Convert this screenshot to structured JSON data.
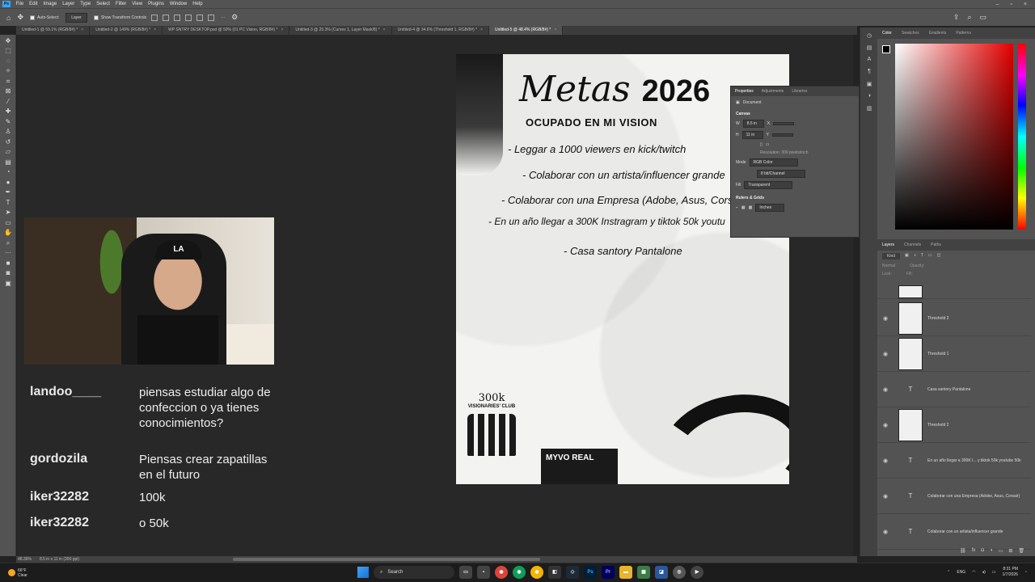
{
  "menubar": {
    "items": [
      "File",
      "Edit",
      "Image",
      "Layer",
      "Type",
      "Select",
      "Filter",
      "View",
      "Plugins",
      "Window",
      "Help"
    ],
    "logo": "Ps"
  },
  "options": {
    "auto_select_label": "Auto-Select:",
    "auto_select_value": "Layer",
    "show_transform_label": "Show Transform Controls",
    "more": "···"
  },
  "tabs": [
    {
      "label": "Untitled-1 @ 59.1% (RGB/8#) *"
    },
    {
      "label": "Untitled-2 @ 149% (RGB/8#) *"
    },
    {
      "label": "WP SNTRY DESKTOP.psd @ 50% (01 PC Vision, RGB/8#) *"
    },
    {
      "label": "Untitled-3 @ 25.3% (Curves 1, Layer Mask/8) *"
    },
    {
      "label": "Untitled-4 @ 34.6% (Threshold 1, RGB/8#) *"
    },
    {
      "label": "Untitled-5 @ 48.4% (RGB/8#) *"
    }
  ],
  "document": {
    "title_script": "Metas",
    "title_year": "2026",
    "subtitle": "OCUPADO EN MI VISION",
    "goals": [
      "- Leggar a 1000 viewers en kick/twitch",
      "- Colaborar con un artista/influencer grande",
      "- Colaborar con una Empresa (Adobe, Asus, Cors",
      "- En un año llegar a 300K Instragram y tiktok 50k youtu",
      "- Casa santory Pantalone"
    ],
    "club_number": "300k",
    "club_label": "VISIONARIES' CLUB",
    "sticker_text": "MYVO REAL"
  },
  "properties": {
    "tabs": [
      "Properties",
      "Adjustments",
      "Libraries"
    ],
    "document_label": "Document",
    "canvas_header": "Canvas",
    "width_label": "W",
    "width_value": "8.5 in",
    "height_label": "H",
    "height_value": "11 in",
    "x_label": "X",
    "y_label": "Y",
    "resolution": "Resolution: 300 pixels/inch",
    "mode_label": "Mode",
    "mode_value": "RGB Color",
    "bits_value": "8 bit/Channel",
    "fill_label": "Fill",
    "fill_value": "Transparent",
    "rulers_header": "Rulers & Grids",
    "units_value": "Inches"
  },
  "color_panel": {
    "tabs": [
      "Color",
      "Swatches",
      "Gradients",
      "Patterns"
    ]
  },
  "layers_panel": {
    "tabs": [
      "Layers",
      "Channels",
      "Paths"
    ],
    "kind_label": "Kind",
    "blend_label": "Normal",
    "opacity_label": "Opacity:",
    "lock_label": "Lock:",
    "fill_label": "Fill:",
    "layers": [
      {
        "name": "",
        "type": "pixel"
      },
      {
        "name": "Threshold 2",
        "type": "pixel"
      },
      {
        "name": "Threshold 1",
        "type": "pixel"
      },
      {
        "name": "Casa santory Pantalone",
        "type": "text"
      },
      {
        "name": "Threshold 2",
        "type": "pixel"
      },
      {
        "name": "En un año llegar a 300K I... y tiktok 50k youtube 50k",
        "type": "text"
      },
      {
        "name": "Colaborar con una Empresa (Adobe, Asus, Corsair)",
        "type": "text"
      },
      {
        "name": "Colaborar con un artista/influencer grande",
        "type": "text"
      }
    ]
  },
  "statusbar": {
    "zoom": "48.36%",
    "doc_info": "8.5 in x 11 in (300 ppi)"
  },
  "chat": [
    {
      "user": "landoo____",
      "text": "piensas estudiar algo de confeccion o ya tienes conocimientos?"
    },
    {
      "user": "gordozila",
      "text": "Piensas crear zapatillas en el futuro"
    },
    {
      "user": "iker32282",
      "text": "100k"
    },
    {
      "user": "iker32282",
      "text": "o 50k"
    }
  ],
  "webcam": {
    "cap_text": "LA"
  },
  "taskbar": {
    "temp": "66°F",
    "weather": "Clear",
    "search_placeholder": "Search",
    "lang": "ENG",
    "time": "8:31 PM",
    "date": "1/7/2026"
  },
  "colors": {
    "ps_blue": "#31a8ff",
    "panel_bg": "#535353",
    "canvas_bg": "#282828"
  }
}
